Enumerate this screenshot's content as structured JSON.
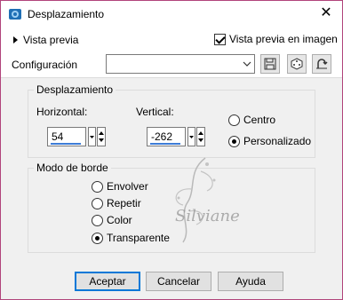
{
  "window": {
    "title": "Desplazamiento",
    "close_glyph": "✕"
  },
  "top": {
    "preview_label": "Vista previa",
    "image_preview_label": "Vista previa en imagen",
    "image_preview_checked": true,
    "config_label": "Configuración",
    "config_value": ""
  },
  "offset_group": {
    "title": "Desplazamiento",
    "horizontal_label": "Horizontal:",
    "horizontal_value": "54",
    "vertical_label": "Vertical:",
    "vertical_value": "-262",
    "center_label": "Centro",
    "custom_label": "Personalizado",
    "selected": "Personalizado"
  },
  "edge_group": {
    "title": "Modo de borde",
    "options": [
      "Envolver",
      "Repetir",
      "Color",
      "Transparente"
    ],
    "selected": "Transparente"
  },
  "watermark_text": "Silviane",
  "buttons": {
    "ok": "Aceptar",
    "cancel": "Cancelar",
    "help": "Ayuda"
  },
  "icons": [
    "app-icon",
    "close-icon",
    "save-icon",
    "random-icon",
    "reset-icon"
  ],
  "colors": {
    "window_border": "#b1447b",
    "accent": "#0078d7",
    "field_underline": "#3d7cd6"
  }
}
